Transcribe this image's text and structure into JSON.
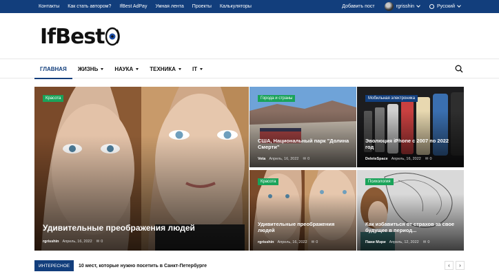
{
  "topbar": {
    "links": [
      "Контакты",
      "Как стать автором?",
      "IfBest AdPay",
      "Умная лента",
      "Проекты",
      "Калькуляторы"
    ],
    "add_post": "Добавить пост",
    "username": "rgrisshin",
    "language": "Русский"
  },
  "logo": {
    "text": "IfBest"
  },
  "mainnav": {
    "items": [
      {
        "label": "ГЛАВНАЯ",
        "active": true
      },
      {
        "label": "ЖИЗНЬ",
        "dropdown": true
      },
      {
        "label": "НАУКА",
        "dropdown": true
      },
      {
        "label": "ТЕХНИКА",
        "dropdown": true
      },
      {
        "label": "IT",
        "dropdown": true
      }
    ]
  },
  "featured": {
    "main": {
      "category": "Красота",
      "title": "Удивительные преображения людей",
      "author": "rgrisshin",
      "date": "Апрель, 16, 2022",
      "comments": "0"
    },
    "top_mid": {
      "category": "Города и страны",
      "title": "США, Национальный парк \"Долина Смерти\"",
      "author": "Veta",
      "date": "Апрель, 16, 2022",
      "comments": "0"
    },
    "top_right": {
      "category": "Мобильная электроника",
      "title": "Эволюция iPhone с 2007 по 2022 год",
      "author": "DeleteSpace",
      "date": "Апрель, 16, 2022",
      "comments": "0"
    },
    "bottom_mid": {
      "category": "Красота",
      "title": "Удивительные преображения людей",
      "author": "rgrisshin",
      "date": "Апрель, 16, 2022",
      "comments": "0"
    },
    "bottom_right": {
      "category": "Психология",
      "title": "Как избавиться от страхов за свое будущее в период...",
      "author": "Пани Мэри",
      "date": "Апрель, 12, 2022",
      "comments": "0"
    }
  },
  "ticker": {
    "label": "ИНТЕРЕСНОЕ",
    "text": "10 мест, которые нужно посетить в Санкт-Петербурге",
    "prev": "‹",
    "next": "›"
  },
  "colors": {
    "brand": "#123e7c",
    "badge_green": "#1aa35a"
  }
}
